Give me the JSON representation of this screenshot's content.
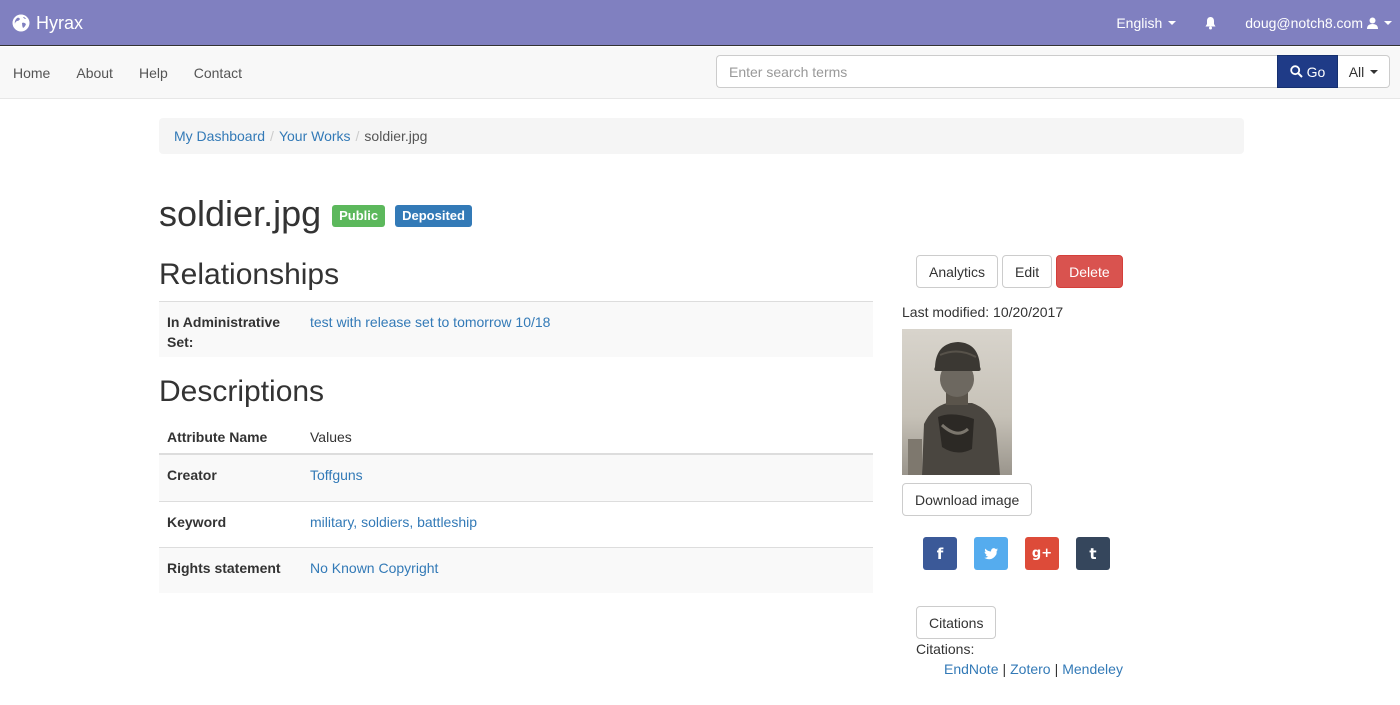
{
  "topbar": {
    "brand": "Hyrax",
    "language": "English",
    "user": "doug@notch8.com"
  },
  "nav": {
    "links": [
      "Home",
      "About",
      "Help",
      "Contact"
    ],
    "search_placeholder": "Enter search terms",
    "search_value": "",
    "go_label": "Go",
    "scope_label": "All"
  },
  "breadcrumb": {
    "items": [
      "My Dashboard",
      "Your Works"
    ],
    "current": "soldier.jpg"
  },
  "work": {
    "title": "soldier.jpg",
    "visibility_label": "Public",
    "state_label": "Deposited"
  },
  "relationships": {
    "heading": "Relationships",
    "admin_set_label": "In Administrative Set:",
    "admin_set_value": "test with release set to tomorrow 10/18"
  },
  "descriptions": {
    "heading": "Descriptions",
    "col_name": "Attribute Name",
    "col_values": "Values",
    "rows": [
      {
        "name": "Creator",
        "value": "Toffguns"
      },
      {
        "name": "Keyword",
        "value": "military, soldiers, battleship"
      },
      {
        "name": "Rights statement",
        "value": "No Known Copyright"
      }
    ]
  },
  "sidebar": {
    "analytics_label": "Analytics",
    "edit_label": "Edit",
    "delete_label": "Delete",
    "last_modified": "Last modified: 10/20/2017",
    "download_label": "Download image",
    "social": [
      {
        "icon": "facebook-icon",
        "glyph": "f",
        "color": "#3b5998"
      },
      {
        "icon": "twitter-icon",
        "glyph": "🐦",
        "color": "#55acee"
      },
      {
        "icon": "google-plus-icon",
        "glyph": "g+",
        "color": "#dd4b39"
      },
      {
        "icon": "tumblr-icon",
        "glyph": "t",
        "color": "#35465c"
      }
    ],
    "citations_button": "Citations",
    "citations_label": "Citations:",
    "citation_links": [
      "EndNote",
      "Zotero",
      "Mendeley"
    ]
  },
  "colors": {
    "topbar": "#8080c0",
    "go_button": "#1f3b87",
    "public_label": "#5cb85c",
    "deposited_label": "#337ab7",
    "danger": "#d9534f",
    "link": "#337ab7"
  }
}
